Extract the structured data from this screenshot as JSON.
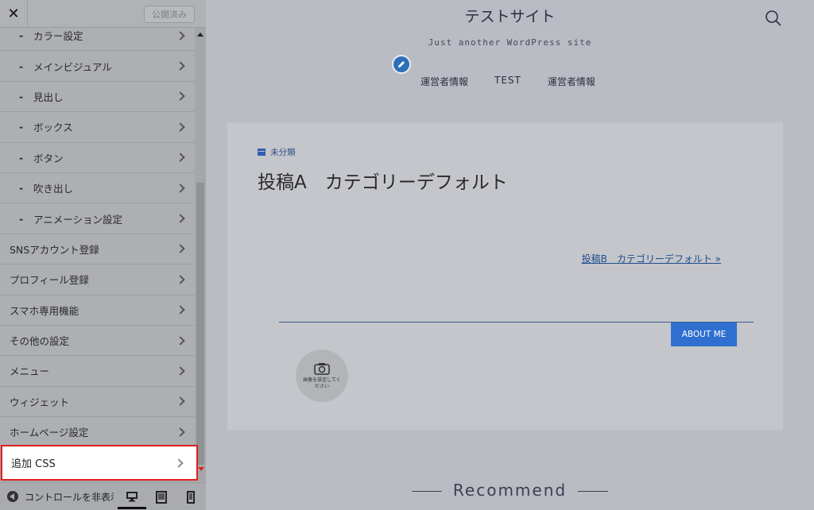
{
  "sidebar": {
    "close_symbol": "✕",
    "publish_label": "公開済み",
    "items": [
      {
        "label": "カラー設定",
        "sub": true
      },
      {
        "label": "メインビジュアル",
        "sub": true
      },
      {
        "label": "見出し",
        "sub": true
      },
      {
        "label": "ボックス",
        "sub": true
      },
      {
        "label": "ボタン",
        "sub": true
      },
      {
        "label": "吹き出し",
        "sub": true
      },
      {
        "label": "アニメーション設定",
        "sub": true
      },
      {
        "label": "SNSアカウント登録",
        "sub": false
      },
      {
        "label": "プロフィール登録",
        "sub": false
      },
      {
        "label": "スマホ専用機能",
        "sub": false
      },
      {
        "label": "その他の設定",
        "sub": false
      },
      {
        "label": "メニュー",
        "sub": false
      },
      {
        "label": "ウィジェット",
        "sub": false
      },
      {
        "label": "ホームページ設定",
        "sub": false
      }
    ],
    "sub_dash": "-",
    "highlighted_item": "追加 CSS",
    "footer": {
      "collapse_label": "コントロールを非表示",
      "devices": [
        "desktop-icon",
        "tablet-icon",
        "mobile-icon"
      ]
    }
  },
  "preview": {
    "site_title": "テストサイト",
    "tagline": "Just another WordPress site",
    "nav": [
      "運営者情報",
      "TEST",
      "運営者情報"
    ],
    "post": {
      "category": "未分類",
      "title": "投稿A　カテゴリーデフォルト",
      "next_link": "投稿B　カテゴリーデフォルト »"
    },
    "about_button": "ABOUT ME",
    "avatar_text": "画像を設定してください",
    "recommend": "Recommend"
  },
  "colors": {
    "accent": "#2f6fd0",
    "highlight_border": "#e02020"
  }
}
